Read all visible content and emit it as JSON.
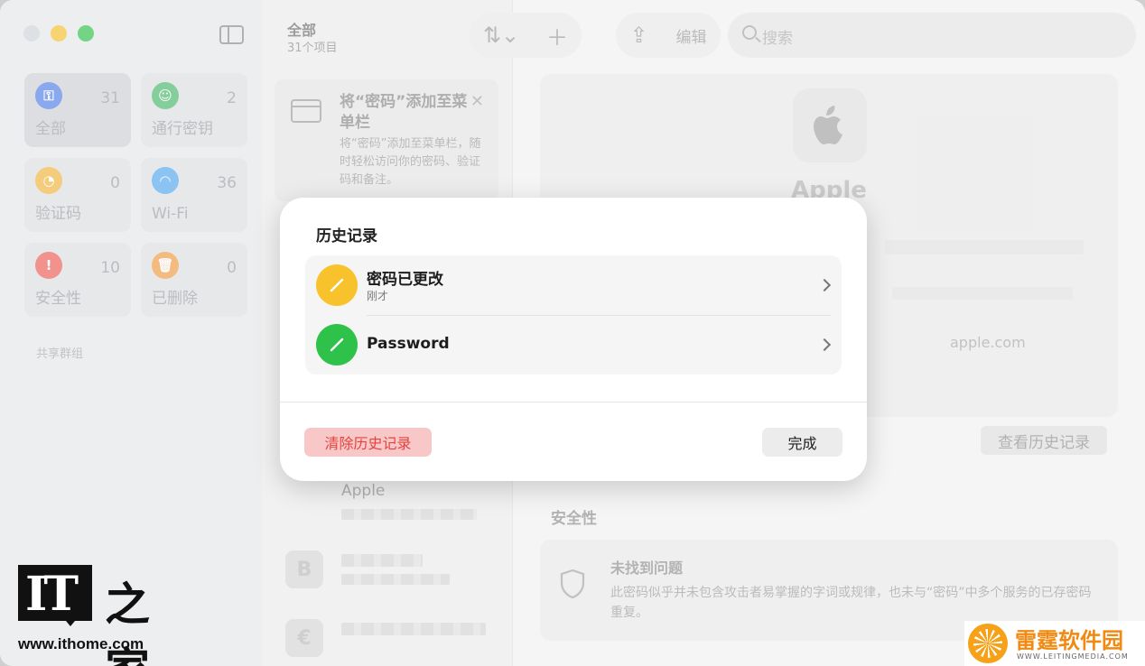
{
  "colors": {
    "accent_yellow": "#F7C22B",
    "accent_green": "#2FC24A",
    "destructive": "#E5443D"
  },
  "sidebar": {
    "tiles": [
      {
        "label": "全部",
        "count": "31",
        "icon": "key-icon",
        "color": "#4F7FE8"
      },
      {
        "label": "通行密钥",
        "count": "2",
        "icon": "person-key-icon",
        "color": "#48B86A"
      },
      {
        "label": "验证码",
        "count": "0",
        "icon": "lock-clock-icon",
        "color": "#F2B53B"
      },
      {
        "label": "Wi-Fi",
        "count": "36",
        "icon": "wifi-icon",
        "color": "#52A8F0"
      },
      {
        "label": "安全性",
        "count": "10",
        "icon": "exclamation-icon",
        "color": "#EE5C55"
      },
      {
        "label": "已删除",
        "count": "0",
        "icon": "trash-icon",
        "color": "#F39A3F"
      }
    ],
    "shared_groups_label": "共享群组"
  },
  "list": {
    "title": "全部",
    "subtitle": "31个项目",
    "promo": {
      "title": "将“密码”添加至菜单栏",
      "description": "将“密码”添加至菜单栏，随时轻松访问你的密码、验证码和备注。"
    },
    "items": [
      {
        "name": "Apple",
        "icon_letter": ""
      },
      {
        "name": "",
        "icon_letter": "B"
      },
      {
        "name": "",
        "icon_letter": "€"
      }
    ]
  },
  "toolbar": {
    "edit_label": "编辑",
    "search_placeholder": "搜索"
  },
  "detail": {
    "app_name": "Apple",
    "website": "apple.com",
    "view_history_label": "查看历史记录",
    "security_heading": "安全性",
    "security_title": "未找到问题",
    "security_desc": "此密码似乎并未包含攻击者易掌握的字词或规律，也未与“密码”中多个服务的已存密码重复。"
  },
  "modal": {
    "title": "历史记录",
    "entries": [
      {
        "title": "密码已更改",
        "subtitle": "刚才",
        "color": "#F7C22B"
      },
      {
        "title": "Password",
        "subtitle": "",
        "color": "#2FC24A"
      }
    ],
    "clear_label": "清除历史记录",
    "done_label": "完成"
  },
  "watermarks": {
    "ithome_logo": "IT",
    "ithome_brush": "之家",
    "ithome_url": "www.ithome.com",
    "leiting_name": "雷霆软件园",
    "leiting_url": "WWW.LEITINGMEDIA.COM"
  }
}
